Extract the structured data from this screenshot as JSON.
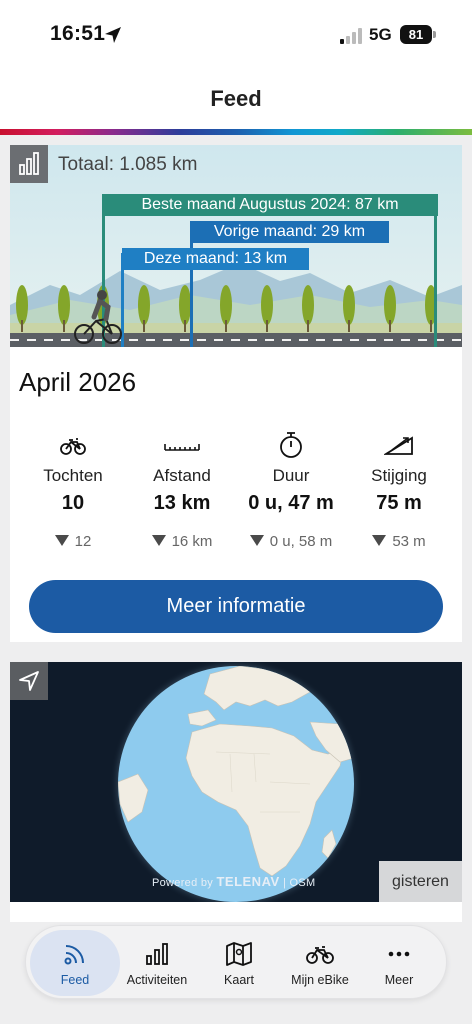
{
  "status_bar": {
    "time": "16:51",
    "network": "5G",
    "battery": "81"
  },
  "nav": {
    "title": "Feed"
  },
  "stats_card": {
    "total": "Totaal: 1.085 km",
    "best_month": "Beste maand Augustus 2024: 87 km",
    "previous_month": "Vorige maand: 29 km",
    "this_month": "Deze maand: 13 km",
    "month_title": "April 2026",
    "stats": [
      {
        "icon": "bike-icon",
        "label": "Tochten",
        "value": "10",
        "prev": "12"
      },
      {
        "icon": "ruler-icon",
        "label": "Afstand",
        "value": "13 km",
        "prev": "16 km"
      },
      {
        "icon": "stopwatch-icon",
        "label": "Duur",
        "value": "0 u, 47 m",
        "prev": "0 u, 58 m"
      },
      {
        "icon": "elevation-icon",
        "label": "Stijging",
        "value": "75 m",
        "prev": "53 m"
      }
    ],
    "more_button": "Meer informatie"
  },
  "map_card": {
    "attribution_prefix": "Powered by",
    "attribution_brand": "TELENAV",
    "attribution_suffix": "| OSM",
    "when": "gisteren"
  },
  "tabs": [
    {
      "icon": "feed-icon",
      "label": "Feed",
      "active": true
    },
    {
      "icon": "activities-icon",
      "label": "Activiteiten",
      "active": false
    },
    {
      "icon": "map-icon",
      "label": "Kaart",
      "active": false
    },
    {
      "icon": "ebike-icon",
      "label": "Mijn eBike",
      "active": false
    },
    {
      "icon": "more-icon",
      "label": "Meer",
      "active": false
    }
  ],
  "colors": {
    "accent": "#1c5ba4",
    "best_bar": "#2a8c7a",
    "prev_bar": "#1c6fb5",
    "this_bar": "#1f7fc4"
  }
}
